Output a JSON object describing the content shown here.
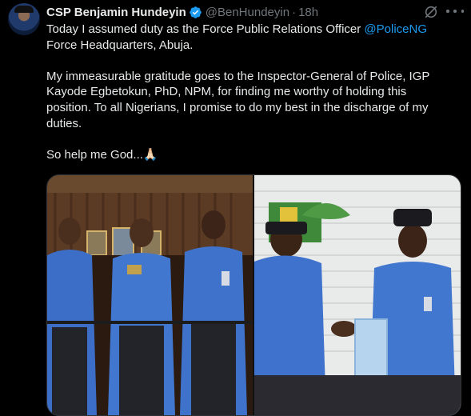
{
  "tweet": {
    "author_name": "CSP Benjamin Hundeyin",
    "handle": "@BenHundeyin",
    "separator": "·",
    "time": "18h",
    "text_lines": [
      {
        "before": "Today I assumed duty as the Force Public Relations Officer ",
        "mention": "@PoliceNG"
      },
      {
        "before": "Force Headquarters, Abuja."
      },
      {
        "before": "My immeasurable gratitude goes to the Inspector-General of Police, IGP"
      },
      {
        "before": "Kayode Egbetokun, PhD, NPM, for finding me worthy of holding this"
      },
      {
        "before": "position. To all Nigerians, I promise to do my best in the discharge of my"
      },
      {
        "before": "duties."
      },
      {
        "before": "So help me God...🙏🏻"
      }
    ]
  },
  "icons": {
    "verified": "verified-badge-icon",
    "grok": "grok-icon",
    "more": "more-dots-icon"
  },
  "colors": {
    "background": "#000000",
    "text": "#e7e9ea",
    "muted": "#71767b",
    "link": "#1d9bf0",
    "verified": "#1d9bf0"
  },
  "media": {
    "count": 2
  }
}
